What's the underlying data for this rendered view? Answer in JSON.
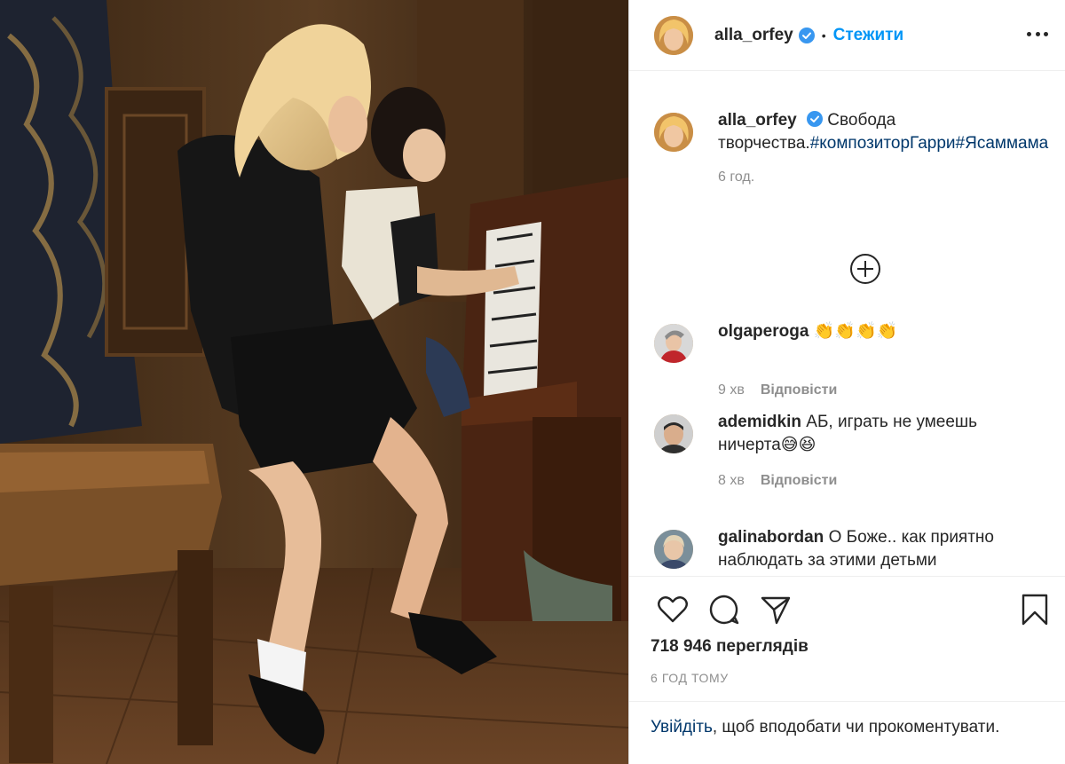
{
  "post": {
    "username": "alla_orfey",
    "separator": "•",
    "follow_label": "Стежити"
  },
  "caption": {
    "username": "alla_orfey",
    "text": "Свобода творчества.",
    "hashtags": "#композиторГарри#Ясаммама",
    "time": "6 год."
  },
  "comments": [
    {
      "username": "olgaperoga",
      "text": "👏👏👏👏",
      "time": "9 хв",
      "reply_label": "Відповісти"
    },
    {
      "username": "ademidkin",
      "text": "АБ, играть не умеешь ничерта😅😆",
      "time": "8 хв",
      "reply_label": "Відповісти"
    },
    {
      "username": "galinabordan",
      "text": "О Боже.. как приятно наблюдать за этими детьми"
    }
  ],
  "actions": {
    "icons": [
      "heart-icon",
      "comment-icon",
      "share-icon",
      "bookmark-icon"
    ],
    "views": "718 946 переглядів",
    "time_ago": "6 ГОД ТОМУ"
  },
  "login": {
    "link_label": "Увійдіть",
    "rest": ", щоб вподобати чи прокоментувати."
  },
  "colors": {
    "accent": "#0095f6",
    "hashtag": "#00376b",
    "muted": "#8e8e8e"
  }
}
